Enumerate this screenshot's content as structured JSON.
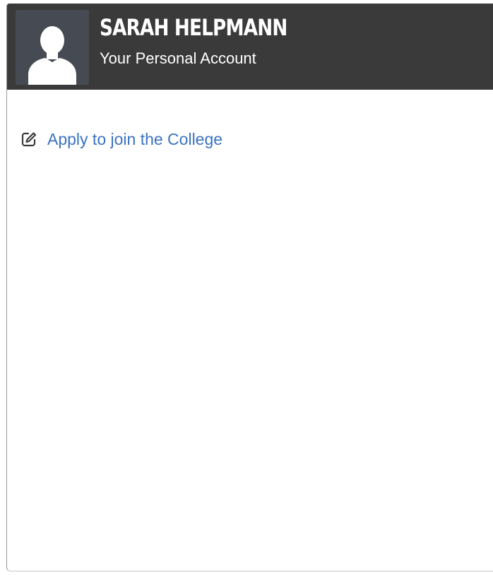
{
  "profile": {
    "name": "SARAH HELPMANN",
    "subtitle": "Your Personal Account",
    "avatar_icon": "user-silhouette-icon"
  },
  "actions": {
    "apply_label": "Apply to join the College",
    "apply_icon": "edit-icon"
  },
  "colors": {
    "header_background": "#3a3a3a",
    "avatar_background": "#464a52",
    "link": "#3b73c0"
  }
}
